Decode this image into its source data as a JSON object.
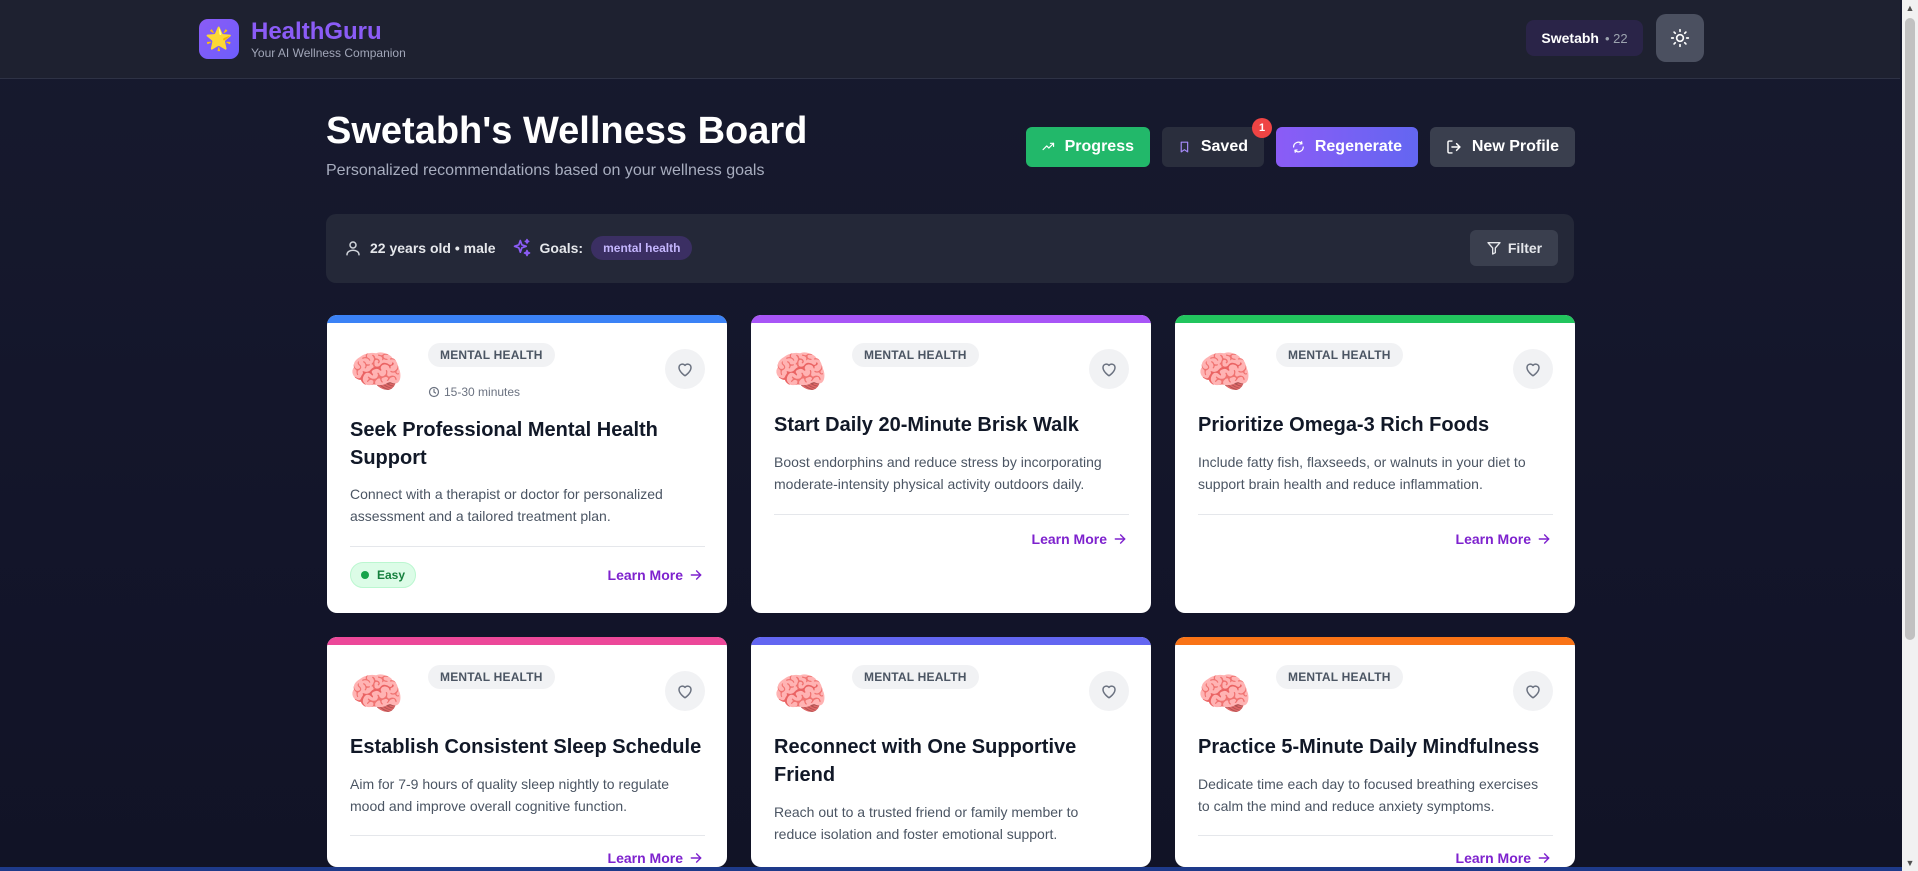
{
  "header": {
    "brand_logo": "🌟",
    "brand_name": "HealthGuru",
    "brand_tagline": "Your AI Wellness Companion",
    "user_name": "Swetabh",
    "user_age": "• 22",
    "theme_icon": "sun-icon"
  },
  "board": {
    "title": "Swetabh's Wellness Board",
    "subtitle": "Personalized recommendations based on your wellness goals"
  },
  "actions": {
    "progress": "Progress",
    "saved": "Saved",
    "saved_count": "1",
    "regenerate": "Regenerate",
    "new_profile": "New Profile"
  },
  "profile_bar": {
    "summary": "22 years old • male",
    "goals_label": "Goals:",
    "goal": "mental health",
    "filter": "Filter"
  },
  "cards": [
    {
      "emoji": "🧠",
      "category": "MENTAL HEALTH",
      "time": "15-30 minutes",
      "title": "Seek Professional Mental Health Support",
      "description": "Connect with a therapist or doctor for personalized assessment and a tailored treatment plan.",
      "difficulty": "Easy",
      "learn_more": "Learn More",
      "accent": "#3b82f6"
    },
    {
      "emoji": "🧠",
      "category": "MENTAL HEALTH",
      "title": "Start Daily 20-Minute Brisk Walk",
      "description": "Boost endorphins and reduce stress by incorporating moderate-intensity physical activity outdoors daily.",
      "learn_more": "Learn More",
      "accent": "#a855f7"
    },
    {
      "emoji": "🧠",
      "category": "MENTAL HEALTH",
      "title": "Prioritize Omega-3 Rich Foods",
      "description": "Include fatty fish, flaxseeds, or walnuts in your diet to support brain health and reduce inflammation.",
      "learn_more": "Learn More",
      "accent": "#22c55e"
    },
    {
      "emoji": "🧠",
      "category": "MENTAL HEALTH",
      "title": "Establish Consistent Sleep Schedule",
      "description": "Aim for 7-9 hours of quality sleep nightly to regulate mood and improve overall cognitive function.",
      "learn_more": "Learn More",
      "accent": "#ec4899"
    },
    {
      "emoji": "🧠",
      "category": "MENTAL HEALTH",
      "title": "Reconnect with One Supportive Friend",
      "description": "Reach out to a trusted friend or family member to reduce isolation and foster emotional support.",
      "learn_more": "Learn More",
      "accent": "#6366f1"
    },
    {
      "emoji": "🧠",
      "category": "MENTAL HEALTH",
      "title": "Practice 5-Minute Daily Mindfulness",
      "description": "Dedicate time each day to focused breathing exercises to calm the mind and reduce anxiety symptoms.",
      "learn_more": "Learn More",
      "accent": "#f97316"
    }
  ]
}
